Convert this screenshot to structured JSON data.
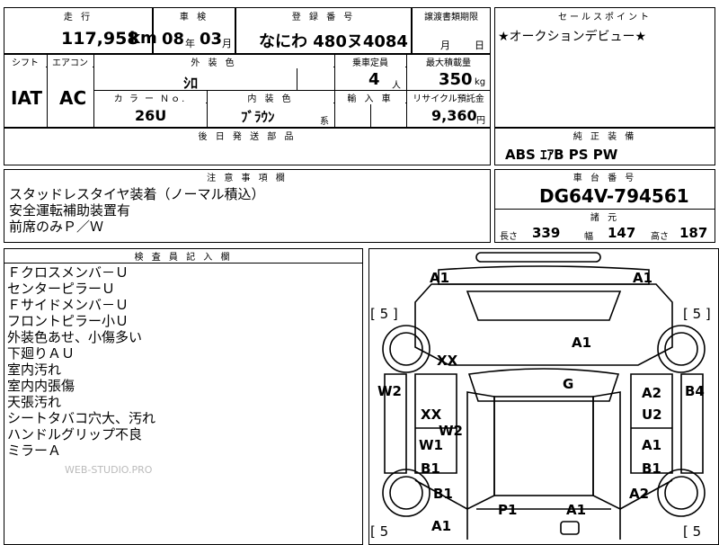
{
  "header": {
    "mileage_label": "走 行",
    "inspection_label": "車 検",
    "registration_label": "登 録 番 号",
    "transfer_label": "譲渡書類期限",
    "sales_point_label": "セールスポイント",
    "mileage_value": "117,958",
    "mileage_unit": "km",
    "inspection_year": "08",
    "inspection_year_unit": "年",
    "inspection_month": "03",
    "inspection_month_unit": "月",
    "registration_value": "なにわ 480ヌ4084",
    "transfer_month_unit": "月",
    "transfer_day_unit": "日",
    "sales_point_text": "★オークションデビュー★"
  },
  "specs": {
    "shift_label": "シフト",
    "aircon_label": "エアコン",
    "exterior_label": "外 装 色",
    "capacity_label": "乗車定員",
    "max_load_label": "最大積載量",
    "shift_value": "IAT",
    "aircon_value": "AC",
    "exterior_value": "ｼﾛ",
    "capacity_value": "4",
    "capacity_unit": "人",
    "max_load_value": "350",
    "max_load_unit": "kg",
    "color_no_label": "カ ラ ー Ｎｏ.",
    "interior_label": "内 装 色",
    "import_label": "輸 入 車",
    "recycle_label": "リサイクル預託金",
    "color_no_value": "26U",
    "interior_value": "ﾌﾞﾗｳﾝ",
    "interior_suffix": "系",
    "recycle_value": "9,360",
    "recycle_unit": "円",
    "aftermarket_label": "後 日 発 送 部 品",
    "factory_equip_label": "純 正 装 備",
    "factory_equip_value": "ABS ｴｱB PS PW"
  },
  "notes_section": {
    "label": "注 意 事 項 欄",
    "lines": [
      "スタッドレスタイヤ装着（ノーマル積込）",
      "安全運転補助装置有",
      "前席のみＰ／Ｗ"
    ]
  },
  "chassis": {
    "label": "車 台 番 号",
    "value": "DG64V-794561",
    "dims_label": "諸 元",
    "length_label": "長さ",
    "length_value": "339",
    "width_label": "幅",
    "width_value": "147",
    "height_label": "高さ",
    "height_value": "187"
  },
  "inspector": {
    "label": "検 査 員 記 入 欄",
    "lines": [
      "Ｆクロスメンバ－Ｕ",
      "センターピラーＵ",
      "Ｆサイドメンバ－Ｕ",
      "フロントピラー小Ｕ",
      "外装色あせ、小傷多い",
      "下廻りＡＵ",
      "室内汚れ",
      "室内内張傷",
      "天張汚れ",
      "シートタバコ穴大、汚れ",
      "ハンドルグリップ不良",
      "ミラーＡ"
    ],
    "watermark": "WEB-STUDIO.PRO"
  },
  "diagram": {
    "tire_depth_tl": "[ 5 ]",
    "tire_depth_tr": "[ 5 ]",
    "tire_depth_bl": "[ 5",
    "tire_depth_br": "[ 5",
    "marks": {
      "a1_top_left": "A1",
      "a1_top_right": "A1",
      "a1_hood": "A1",
      "xx_left": "XX",
      "w2_left": "W2",
      "b4_right": "B4",
      "g_windshield": "G",
      "a2_right_door": "A2",
      "u2_right_door": "U2",
      "xx_left_door": "XX",
      "w2_center": "W2",
      "w1_left": "W1",
      "a1_right_rear_door": "A1",
      "b1_left_door": "B1",
      "b1_right_rear_door": "B1",
      "b1_left_rear": "B1",
      "a2_right_rear": "A2",
      "p1_rear": "P1",
      "a1_rear_center": "A1",
      "a1_bottom_left": "A1"
    }
  }
}
